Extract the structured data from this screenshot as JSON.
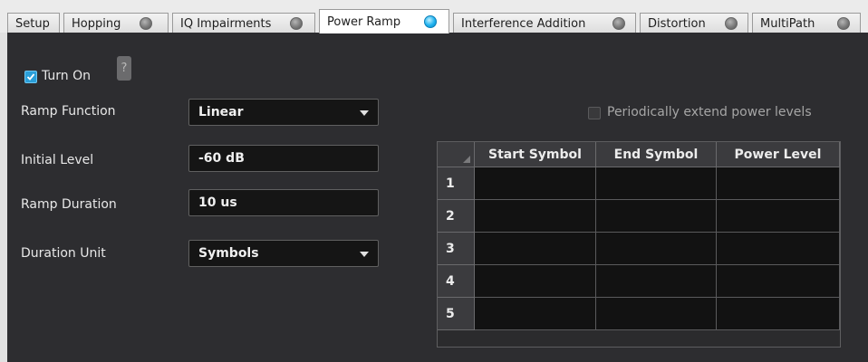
{
  "tabs": [
    {
      "label": "Setup"
    },
    {
      "label": "Hopping"
    },
    {
      "label": "IQ Impairments"
    },
    {
      "label": "Power Ramp"
    },
    {
      "label": "Interference Addition"
    },
    {
      "label": "Distortion"
    },
    {
      "label": "MultiPath"
    }
  ],
  "active_tab": "Power Ramp",
  "panel": {
    "turn_on_label": "Turn On",
    "turn_on_checked": true,
    "help_label": "?",
    "ramp_function": {
      "label": "Ramp Function",
      "value": "Linear"
    },
    "initial_level": {
      "label": "Initial Level",
      "value": "-60 dB"
    },
    "ramp_duration": {
      "label": "Ramp Duration",
      "value": "10 us"
    },
    "duration_unit": {
      "label": "Duration Unit",
      "value": "Symbols"
    },
    "periodic_label": "Periodically extend power levels",
    "periodic_checked": false
  },
  "table": {
    "columns": [
      "Start Symbol",
      "End Symbol",
      "Power Level"
    ],
    "rows": [
      "1",
      "2",
      "3",
      "4",
      "5"
    ]
  },
  "colors": {
    "accent": "#1fb2ef",
    "panel_bg": "#2d2d30",
    "field_bg": "#151515"
  }
}
